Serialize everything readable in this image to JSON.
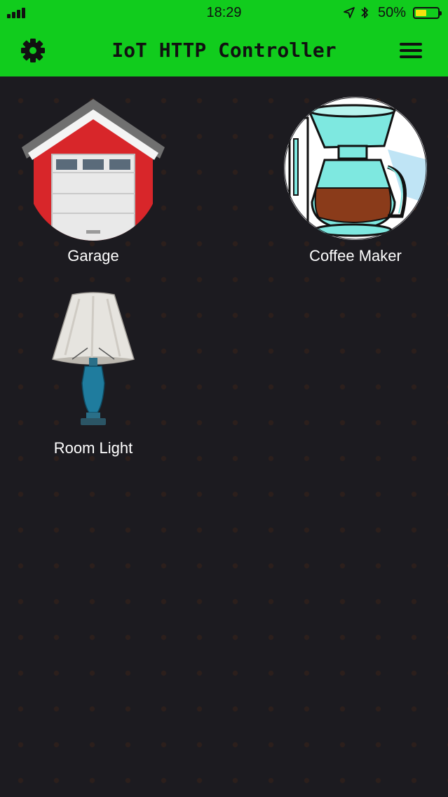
{
  "status_bar": {
    "time": "18:29",
    "battery_percent": "50%",
    "battery_level": 0.5,
    "icons": [
      "signal-bars-icon",
      "location-arrow-icon",
      "bluetooth-icon",
      "battery-icon"
    ]
  },
  "header": {
    "title": "IoT HTTP Controller",
    "left_icon": "gear-icon",
    "right_icon": "hamburger-menu-icon",
    "background_color": "#11cc1d"
  },
  "devices": [
    {
      "label": "Garage",
      "icon": "garage-icon"
    },
    {
      "label": "Coffee Maker",
      "icon": "coffee-maker-icon"
    },
    {
      "label": "Room Light",
      "icon": "lamp-icon"
    }
  ],
  "theme": {
    "background": "#1c1b20",
    "text": "#ffffff"
  }
}
